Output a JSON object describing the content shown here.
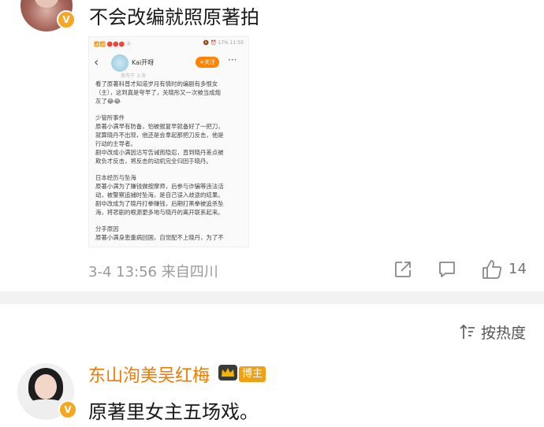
{
  "comments": [
    {
      "text": "不会改编就照原著拍",
      "verified_badge": "V",
      "screenshot": {
        "status_left": "📶📶 🔴🔴🔴 ⓓ",
        "status_right": "🔕 ⏰ 17% 11:55",
        "author": "Kai开呀",
        "follow_label": "+关注",
        "more_label": "···",
        "ghost_text": "发布于 上海",
        "lines": [
          "看了原著科普才知道岁月有情时的编剧有多恨女",
          "（主），这到真是夸早了，关晓彤又一次被当成炮",
          "灰了😂😂",
          "",
          "少管所事件",
          "原著小满早有防备，怕被报复早就备好了一把刀，",
          "就算晓丹不出现，他还是会拿起那把刀反击，他是",
          "行动的主导者。",
          "剧中改成小满因沽写告诫而隐忍，直到晓丹差点被",
          "欺负才反击，将反击的动机完全归因于晓丹。",
          "",
          "日本经历与坠海",
          "原著小满为了赚钱做按摩师，后参与诈骗等违法活",
          "动，被警察追捕时坠海，是自己误入歧途的结果。",
          "剧中改成为了晓丹打拳赚钱，后期打黑拳被追杀坠",
          "海，将悲剧的根源更多地与晓丹的离开联系起来。",
          "",
          "分手原因",
          "原著小满身患重病回国，自觉配不上晓丹，为了不"
        ]
      },
      "timestamp": "3-4 13:56",
      "location": "来自四川",
      "like_count": "14"
    },
    {
      "username": "东山洵美吴红梅",
      "role_badge": "博主",
      "verified_badge": "V",
      "text": "原著里女主五场戏。"
    }
  ],
  "sort": {
    "label": "按热度"
  },
  "colors": {
    "accent": "#ff8200",
    "username": "#f07a00",
    "meta": "#9a9a9a",
    "badge": "#f5a623"
  },
  "icons": [
    "share-icon",
    "comment-icon",
    "like-icon",
    "sort-icon",
    "crown-icon",
    "verified-icon"
  ]
}
